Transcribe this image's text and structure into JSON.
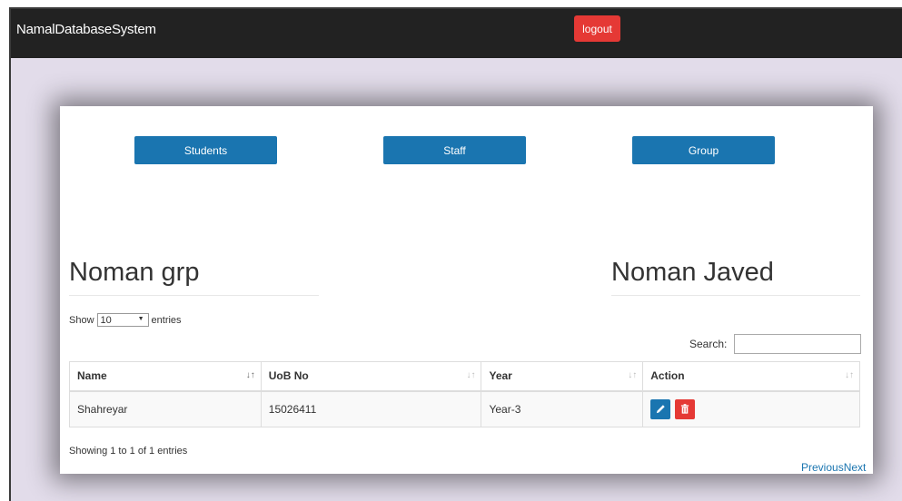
{
  "navbar": {
    "brand": "NamalDatabaseSystem",
    "logout_label": "logout"
  },
  "nav_buttons": {
    "students": "Students",
    "staff": "Staff",
    "group": "Group"
  },
  "group": {
    "name": "Noman grp",
    "supervisor": "Noman Javed"
  },
  "table_controls": {
    "show_label": "Show",
    "entries_value": "10",
    "entries_label": "entries",
    "search_label": "Search:",
    "search_value": ""
  },
  "table": {
    "columns": [
      "Name",
      "UoB No",
      "Year",
      "Action"
    ],
    "rows": [
      {
        "name": "Shahreyar",
        "uob_no": "15026411",
        "year": "Year-3"
      }
    ]
  },
  "footer": {
    "info": "Showing 1 to 1 of 1 entries",
    "previous": "Previous",
    "next": "Next"
  },
  "colors": {
    "navbar": "#222222",
    "primary": "#1a75b0",
    "danger": "#e53935",
    "background": "#e2dcea"
  }
}
